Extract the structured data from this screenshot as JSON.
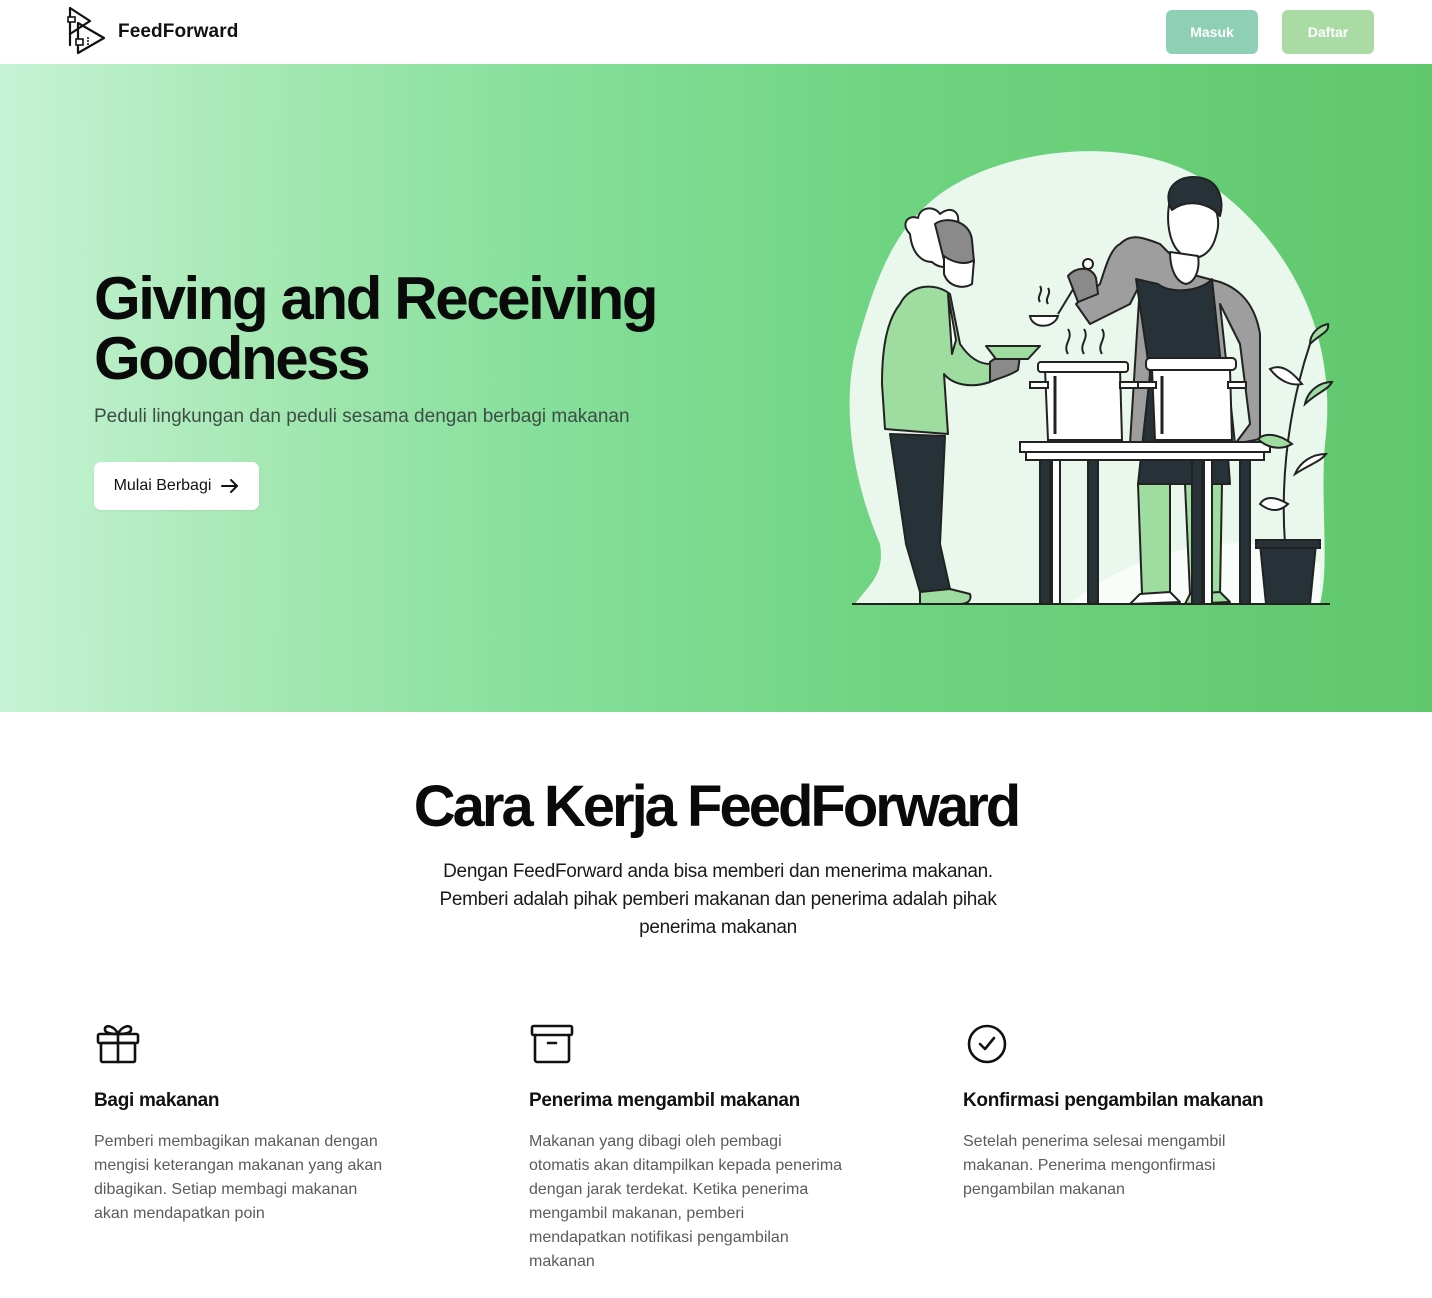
{
  "header": {
    "brand": "FeedForward",
    "login_label": "Masuk",
    "register_label": "Daftar"
  },
  "hero": {
    "title": "Giving and Receiving Goodness",
    "subtitle": "Peduli lingkungan dan peduli sesama dengan berbagi makanan",
    "cta_label": "Mulai Berbagi",
    "cta_icon": "arrow-right-icon",
    "illustration": "people-sharing-food-illustration"
  },
  "how": {
    "title": "Cara Kerja FeedForward",
    "description": "Dengan FeedForward anda bisa memberi dan menerima makanan. Pemberi adalah pihak pemberi makanan dan penerima adalah pihak penerima makanan",
    "features": [
      {
        "icon": "gift-icon",
        "title": "Bagi makanan",
        "text": "Pemberi membagikan makanan dengan mengisi keterangan makanan yang akan dibagikan. Setiap membagi makanan akan mendapatkan poin"
      },
      {
        "icon": "archive-box-icon",
        "title": "Penerima mengambil makanan",
        "text": "Makanan yang dibagi oleh pembagi otomatis akan ditampilkan kepada penerima dengan jarak terdekat. Ketika penerima mengambil makanan, pemberi mendapatkan notifikasi pengambilan makanan"
      },
      {
        "icon": "check-circle-icon",
        "title": "Konfirmasi pengambilan makanan",
        "text": "Setelah penerima selesai mengambil makanan. Penerima mengonfirmasi pengambilan makanan"
      }
    ]
  },
  "colors": {
    "hero_gradient_start": "#c6f3d4",
    "hero_gradient_end": "#60c76c",
    "masuk_button": "#8fcfb6",
    "daftar_button": "#abdba5"
  }
}
